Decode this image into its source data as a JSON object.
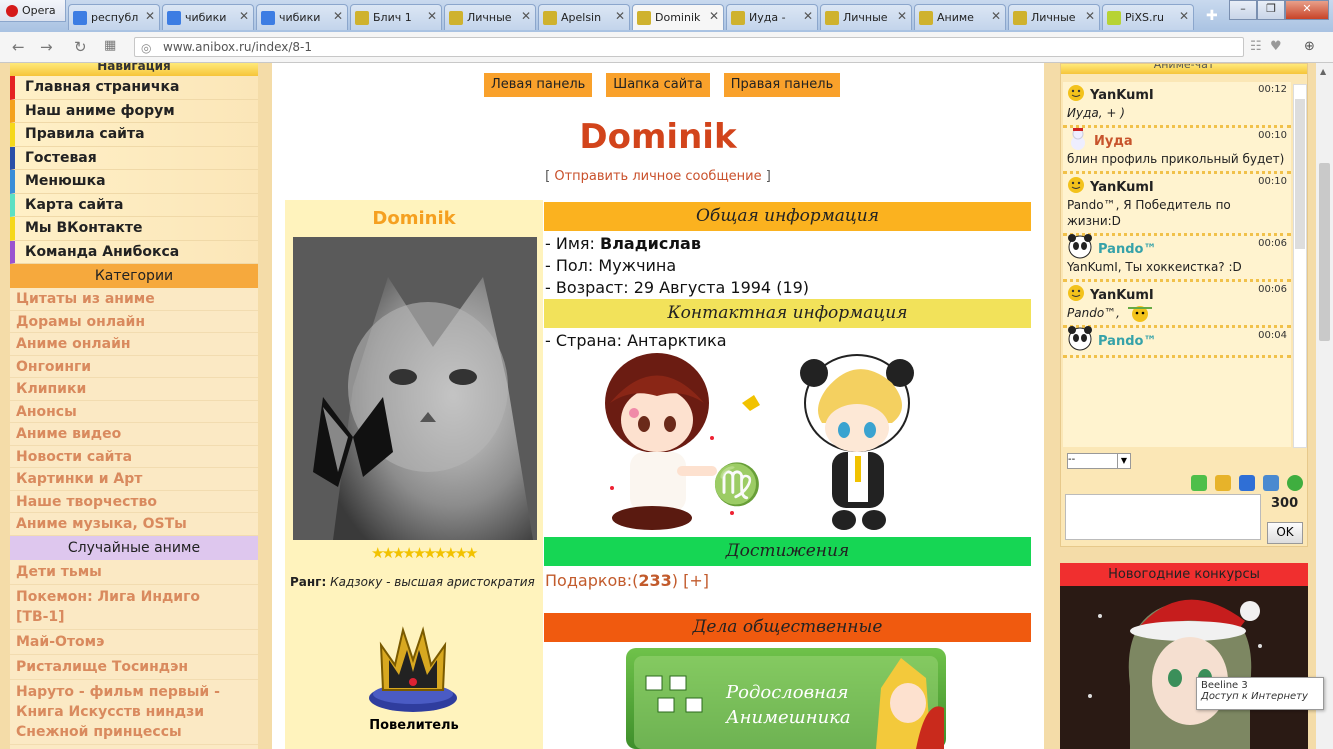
{
  "browser": {
    "opera_label": "Opera",
    "tabs": [
      {
        "label": "республ",
        "icon": "google-icon",
        "color": "#3d7de3"
      },
      {
        "label": "чибики",
        "icon": "google-icon",
        "color": "#3d7de3"
      },
      {
        "label": "чибики",
        "icon": "google-icon",
        "color": "#3d7de3"
      },
      {
        "label": "Блич 1",
        "icon": "site-icon",
        "color": "#cfb22e"
      },
      {
        "label": "Личные",
        "icon": "site-icon",
        "color": "#cfb22e"
      },
      {
        "label": "Apelsin",
        "icon": "site-icon",
        "color": "#cfb22e"
      },
      {
        "label": "Dominik",
        "icon": "site-icon",
        "color": "#cfb22e",
        "active": true
      },
      {
        "label": "Иуда - ",
        "icon": "site-icon",
        "color": "#cfb22e"
      },
      {
        "label": "Личные",
        "icon": "site-icon",
        "color": "#cfb22e"
      },
      {
        "label": "Аниме",
        "icon": "site-icon",
        "color": "#cfb22e"
      },
      {
        "label": "Личные",
        "icon": "site-icon",
        "color": "#cfb22e"
      },
      {
        "label": "PiXS.ru",
        "icon": "pixs-icon",
        "color": "#b7d334"
      }
    ],
    "url": "www.anibox.ru/index/8-1"
  },
  "left": {
    "nav_title": "Навигация",
    "nav": [
      {
        "label": "Главная страничка",
        "color": "#e52322"
      },
      {
        "label": "Наш аниме форум",
        "color": "#f4a21d"
      },
      {
        "label": "Правила сайта",
        "color": "#f5d81a"
      },
      {
        "label": "Гостевая",
        "color": "#2b4fa8"
      },
      {
        "label": "Менюшка",
        "color": "#3a8ed8"
      },
      {
        "label": "Карта сайта",
        "color": "#5de0c3"
      },
      {
        "label": "Мы ВКонтакте",
        "color": "#f5d81a"
      },
      {
        "label": "Команда Анибокса",
        "color": "#9a54d0"
      }
    ],
    "categories_title": "Категории",
    "categories": [
      "Цитаты из аниме",
      "Дорамы онлайн",
      "Аниме онлайн",
      "Онгоинги",
      "Клипики",
      "Анонсы",
      "Аниме видео",
      "Новости сайта",
      "Картинки и Арт",
      "Наше творчество",
      "Аниме музыка, OSTы"
    ],
    "random_title": "Случайные аниме",
    "random": [
      "Дети тьмы",
      "Покемон: Лига Индиго [ТВ-1]",
      "Май-Отомэ",
      "Ристалище Тосиндэн",
      "Наруто - фильм первый - Книга Искусств ниндзи Снежной принцессы"
    ]
  },
  "center": {
    "buttons": [
      "Левая панель",
      "Шапка сайта",
      "Правая панель"
    ],
    "name": "Dominik",
    "pm_link": "Отправить личное сообщение",
    "card_name": "Dominik",
    "stars": "★★★★★★★★★★",
    "rank_label": "Ранг:",
    "rank_value": "Кадзоку - высшая аристократия",
    "rank_title": "Повелитель",
    "general_title": "Общая информация",
    "general": [
      {
        "label": "- Имя: ",
        "value": "Владислав",
        "bold": true
      },
      {
        "label": "- Пол: ",
        "value": "Мужчина"
      },
      {
        "label": "- Возраст: ",
        "value": "29 Августа 1994 (19)"
      }
    ],
    "contact_title": "Контактная информация",
    "country_label": "- Страна: ",
    "country": "Антарктика",
    "achievements_title": "Достижения",
    "gifts_label": "Подарков:(",
    "gifts_count": "233",
    "gifts_close": ")",
    "gifts_plus": "[+]",
    "public_title": "Дела общественные",
    "banner_line1": "Родословная",
    "banner_line2": "Анимешника",
    "colors": {
      "general": "#fbb21f",
      "contact": "#f2e25a",
      "achievements": "#16d654",
      "public": "#f05a0f"
    }
  },
  "chat": {
    "title": "Аниме-чат",
    "messages": [
      {
        "user": "YanKumI",
        "time": "00:12",
        "text": "Иуда, + )",
        "italic": true,
        "avatar": "smiley-icon",
        "cls": ""
      },
      {
        "user": "Иуда",
        "time": "00:10",
        "text": "блин профиль прикольный будет)",
        "italic": false,
        "avatar": "snowman-icon",
        "cls": "c1"
      },
      {
        "user": "YanKumI",
        "time": "00:10",
        "text": "Pando™, Я Победитель по жизни:D",
        "italic": false,
        "avatar": "smiley-icon",
        "cls": ""
      },
      {
        "user": "Pando™",
        "time": "00:06",
        "text": "YanKumI, Ты хоккеистка? :D",
        "italic": false,
        "avatar": "panda-icon",
        "cls": "c2"
      },
      {
        "user": "YanKumI",
        "time": "00:06",
        "text": "Pando™,",
        "italic": true,
        "avatar": "smiley-icon",
        "cls": ""
      },
      {
        "user": "Pando™",
        "time": "00:04",
        "text": "",
        "italic": false,
        "avatar": "panda-icon",
        "cls": "c2"
      }
    ],
    "select_value": "--",
    "char_count": "300",
    "ok_label": "OK"
  },
  "contest": {
    "title": "Новогодние конкурсы"
  },
  "tooltip": {
    "line1": "Beeline 3",
    "line2": "Доступ к Интернету"
  }
}
